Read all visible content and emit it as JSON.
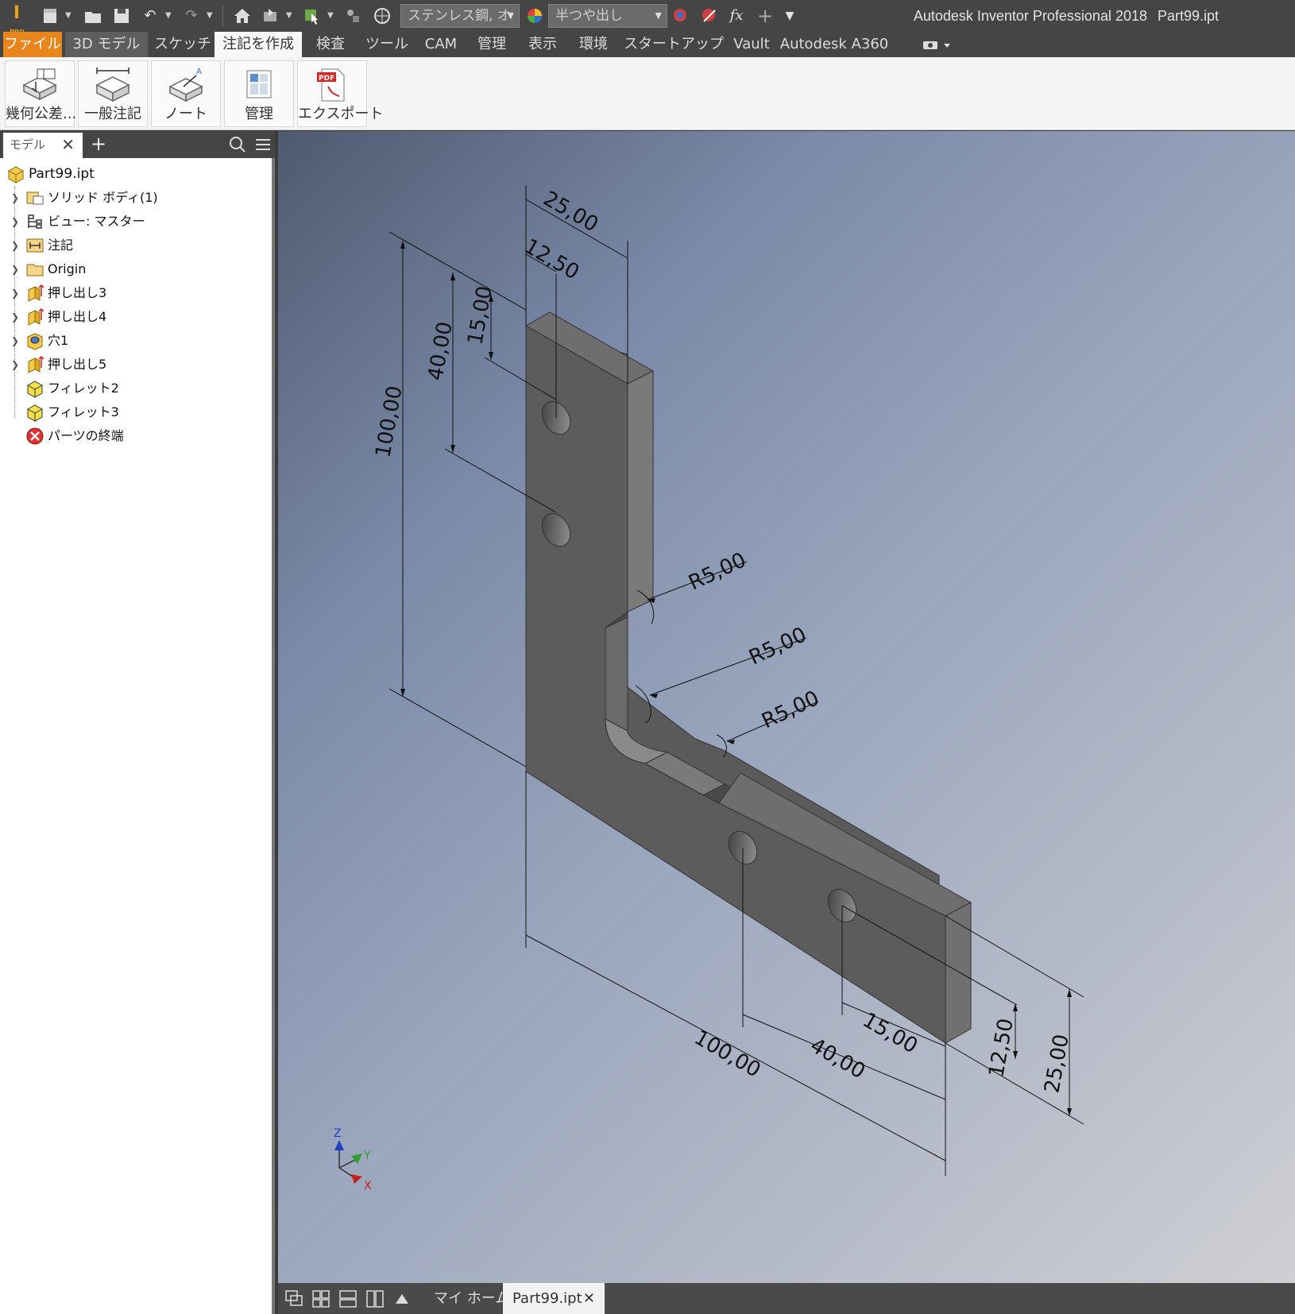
{
  "app": {
    "title": "Autodesk Inventor Professional 2018",
    "file": "Part99.ipt",
    "logo_text": "I",
    "logo_sub": "PRO"
  },
  "quick_access": {
    "material": "ステンレス鋼, オ",
    "appearance": "半つや出し",
    "fx_label": "fx"
  },
  "tabs": [
    {
      "label": "ファイル"
    },
    {
      "label": "3D モデル"
    },
    {
      "label": "スケッチ"
    },
    {
      "label": "注記を作成"
    },
    {
      "label": "検査"
    },
    {
      "label": "ツール"
    },
    {
      "label": "CAM"
    },
    {
      "label": "管理"
    },
    {
      "label": "表示"
    },
    {
      "label": "環境"
    },
    {
      "label": "スタートアップ"
    },
    {
      "label": "Vault"
    },
    {
      "label": "Autodesk A360"
    }
  ],
  "ribbon": {
    "buttons": [
      {
        "label": "幾何公差..."
      },
      {
        "label": "一般注記"
      },
      {
        "label": "ノート"
      },
      {
        "label": "管理"
      },
      {
        "label": "エクスポート"
      }
    ]
  },
  "browser": {
    "tab_label": "モデル",
    "root": "Part99.ipt",
    "items": [
      {
        "label": "ソリッド ボディ(1)",
        "icon": "solid-body-icon",
        "expandable": true
      },
      {
        "label": "ビュー: マスター",
        "icon": "view-icon",
        "expandable": true
      },
      {
        "label": "注記",
        "icon": "annotation-icon",
        "expandable": true
      },
      {
        "label": "Origin",
        "icon": "folder-icon",
        "expandable": true
      },
      {
        "label": "押し出し3",
        "icon": "extrude-icon",
        "expandable": true
      },
      {
        "label": "押し出し4",
        "icon": "extrude-icon",
        "expandable": true
      },
      {
        "label": "穴1",
        "icon": "hole-icon",
        "expandable": true
      },
      {
        "label": "押し出し5",
        "icon": "extrude-icon",
        "expandable": true
      },
      {
        "label": "フィレット2",
        "icon": "fillet-icon",
        "expandable": false
      },
      {
        "label": "フィレット3",
        "icon": "fillet-icon",
        "expandable": false
      },
      {
        "label": "パーツの終端",
        "icon": "end-of-part-icon",
        "expandable": false
      }
    ]
  },
  "dimensions": {
    "top_width": "25,00",
    "top_half": "12,50",
    "hole_spacing_top": "15,00",
    "hole_offset_top": "40,00",
    "height": "100,00",
    "radius_1": "R5,00",
    "radius_2": "R5,00",
    "radius_3": "R5,00",
    "bottom_length": "100,00",
    "hole_offset_bottom": "40,00",
    "hole_spacing_bottom": "15,00",
    "bottom_half": "12,50",
    "bottom_width": "25,00"
  },
  "triad": {
    "x": "X",
    "y": "Y",
    "z": "Z"
  },
  "docbar": {
    "home_tab": "マイ ホーム",
    "part_tab": "Part99.ipt"
  },
  "colors": {
    "accent_file_tab": "#e8861d",
    "part_face": "#5a5a5a"
  }
}
